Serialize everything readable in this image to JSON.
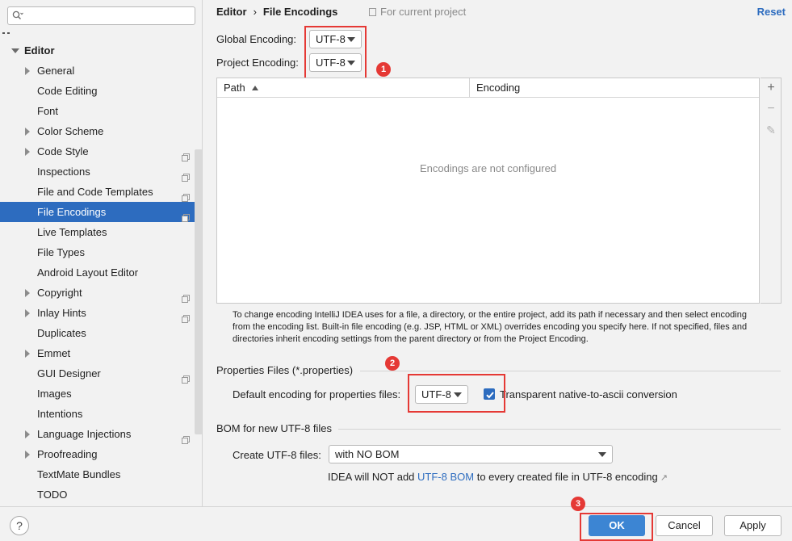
{
  "sidebar": {
    "search": {
      "value": "",
      "placeholder": ""
    },
    "tree": [
      {
        "label": "Editor",
        "top": true,
        "expanded": true
      },
      {
        "label": "General",
        "arrow": true
      },
      {
        "label": "Code Editing"
      },
      {
        "label": "Font"
      },
      {
        "label": "Color Scheme",
        "arrow": true
      },
      {
        "label": "Code Style",
        "arrow": true,
        "copy": true
      },
      {
        "label": "Inspections",
        "copy": true
      },
      {
        "label": "File and Code Templates",
        "copy": true
      },
      {
        "label": "File Encodings",
        "copy": true,
        "selected": true
      },
      {
        "label": "Live Templates"
      },
      {
        "label": "File Types"
      },
      {
        "label": "Android Layout Editor"
      },
      {
        "label": "Copyright",
        "arrow": true,
        "copy": true
      },
      {
        "label": "Inlay Hints",
        "arrow": true,
        "copy": true
      },
      {
        "label": "Duplicates"
      },
      {
        "label": "Emmet",
        "arrow": true
      },
      {
        "label": "GUI Designer",
        "copy": true
      },
      {
        "label": "Images"
      },
      {
        "label": "Intentions"
      },
      {
        "label": "Language Injections",
        "arrow": true,
        "copy": true
      },
      {
        "label": "Proofreading",
        "arrow": true
      },
      {
        "label": "TextMate Bundles"
      },
      {
        "label": "TODO"
      }
    ]
  },
  "header": {
    "breadcrumb_parent": "Editor",
    "breadcrumb_sep": "›",
    "breadcrumb_current": "File Encodings",
    "scope": "For current project",
    "reset": "Reset"
  },
  "encodings": {
    "global_label": "Global Encoding:",
    "global_value": "UTF-8",
    "project_label": "Project Encoding:",
    "project_value": "UTF-8"
  },
  "table": {
    "col_path": "Path",
    "col_encoding": "Encoding",
    "empty": "Encodings are not configured",
    "tool_add": "+",
    "tool_remove": "−",
    "tool_edit": "✎"
  },
  "help_text": "To change encoding IntelliJ IDEA uses for a file, a directory, or the entire project, add its path if necessary and then select encoding from the encoding list. Built-in file encoding (e.g. JSP, HTML or XML) overrides encoding you specify here. If not specified, files and directories inherit encoding settings from the parent directory or from the Project Encoding.",
  "properties": {
    "title": "Properties Files (*.properties)",
    "default_label": "Default encoding for properties files:",
    "default_value": "UTF-8",
    "transparent_label": "Transparent native-to-ascii conversion",
    "transparent_checked": true
  },
  "bom": {
    "title": "BOM for new UTF-8 files",
    "create_label": "Create UTF-8 files:",
    "create_value": "with NO BOM",
    "note_pre": "IDEA will NOT add ",
    "note_link": "UTF-8 BOM",
    "note_post": " to every created file in UTF-8 encoding",
    "note_ext": "↗"
  },
  "annotations": {
    "badge1": "1",
    "badge2": "2",
    "badge3": "3"
  },
  "footer": {
    "help": "?",
    "ok": "OK",
    "cancel": "Cancel",
    "apply": "Apply"
  },
  "colors": {
    "accent": "#2d6cbf",
    "primary_button": "#3c85d3",
    "annotation_red": "#e53935"
  }
}
